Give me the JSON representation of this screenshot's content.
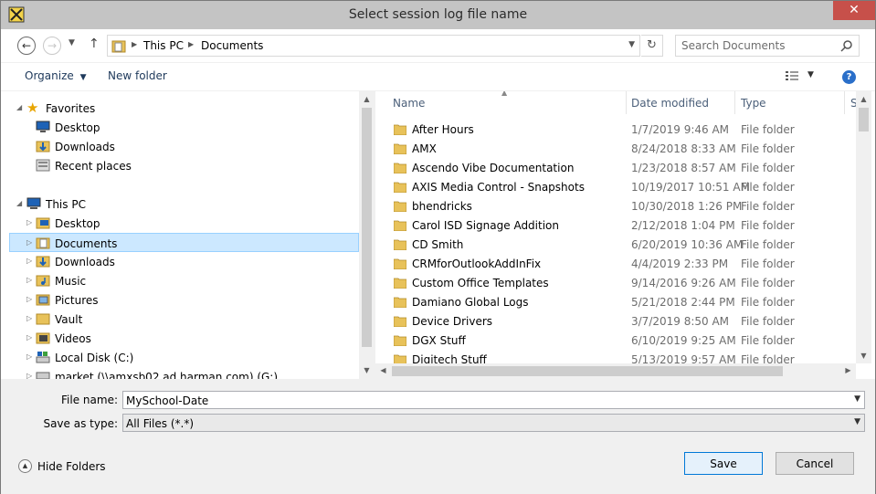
{
  "window": {
    "title": "Select session log file name",
    "close_glyph": "✕"
  },
  "address": {
    "segments": [
      "This PC",
      "Documents"
    ],
    "search_placeholder": "Search Documents"
  },
  "toolbar": {
    "organize_label": "Organize",
    "new_folder_label": "New folder",
    "help_glyph": "?"
  },
  "nav": {
    "favorites": {
      "label": "Favorites",
      "items": [
        {
          "label": "Desktop",
          "icon": "desktop-icon"
        },
        {
          "label": "Downloads",
          "icon": "downloads-icon"
        },
        {
          "label": "Recent places",
          "icon": "recent-places-icon"
        }
      ]
    },
    "this_pc": {
      "label": "This PC",
      "selected": "Documents",
      "items": [
        {
          "label": "Desktop",
          "icon": "desktop-folder-icon"
        },
        {
          "label": "Documents",
          "icon": "documents-icon"
        },
        {
          "label": "Downloads",
          "icon": "downloads-icon"
        },
        {
          "label": "Music",
          "icon": "music-icon"
        },
        {
          "label": "Pictures",
          "icon": "pictures-icon"
        },
        {
          "label": "Vault",
          "icon": "folder-icon"
        },
        {
          "label": "Videos",
          "icon": "videos-icon"
        },
        {
          "label": "Local Disk (C:)",
          "icon": "local-disk-icon"
        },
        {
          "label": "market (\\\\amxsb02.ad.harman.com) (G:)",
          "icon": "network-drive-icon"
        }
      ]
    }
  },
  "files": {
    "columns": [
      "Name",
      "Date modified",
      "Type",
      "S"
    ],
    "rows": [
      {
        "name": "After Hours",
        "date": "1/7/2019 9:46 AM",
        "type": "File folder"
      },
      {
        "name": "AMX",
        "date": "8/24/2018 8:33 AM",
        "type": "File folder"
      },
      {
        "name": "Ascendo Vibe Documentation",
        "date": "1/23/2018 8:57 AM",
        "type": "File folder"
      },
      {
        "name": "AXIS Media Control - Snapshots",
        "date": "10/19/2017 10:51 AM",
        "type": "File folder"
      },
      {
        "name": "bhendricks",
        "date": "10/30/2018 1:26 PM",
        "type": "File folder"
      },
      {
        "name": "Carol ISD Signage Addition",
        "date": "2/12/2018 1:04 PM",
        "type": "File folder"
      },
      {
        "name": "CD Smith",
        "date": "6/20/2019 10:36 AM",
        "type": "File folder"
      },
      {
        "name": "CRMforOutlookAddInFix",
        "date": "4/4/2019 2:33 PM",
        "type": "File folder"
      },
      {
        "name": "Custom Office Templates",
        "date": "9/14/2016 9:26 AM",
        "type": "File folder"
      },
      {
        "name": "Damiano Global Logs",
        "date": "5/21/2018 2:44 PM",
        "type": "File folder"
      },
      {
        "name": "Device Drivers",
        "date": "3/7/2019 8:50 AM",
        "type": "File folder"
      },
      {
        "name": "DGX Stuff",
        "date": "6/10/2019 9:25 AM",
        "type": "File folder"
      },
      {
        "name": "Digitech Stuff",
        "date": "5/13/2019 9:57 AM",
        "type": "File folder"
      }
    ]
  },
  "form": {
    "filename_label": "File name:",
    "filename_value": "MySchool-Date",
    "savetype_label": "Save as type:",
    "savetype_value": "All Files (*.*)",
    "hide_folders_label": "Hide Folders",
    "save_label": "Save",
    "cancel_label": "Cancel"
  }
}
